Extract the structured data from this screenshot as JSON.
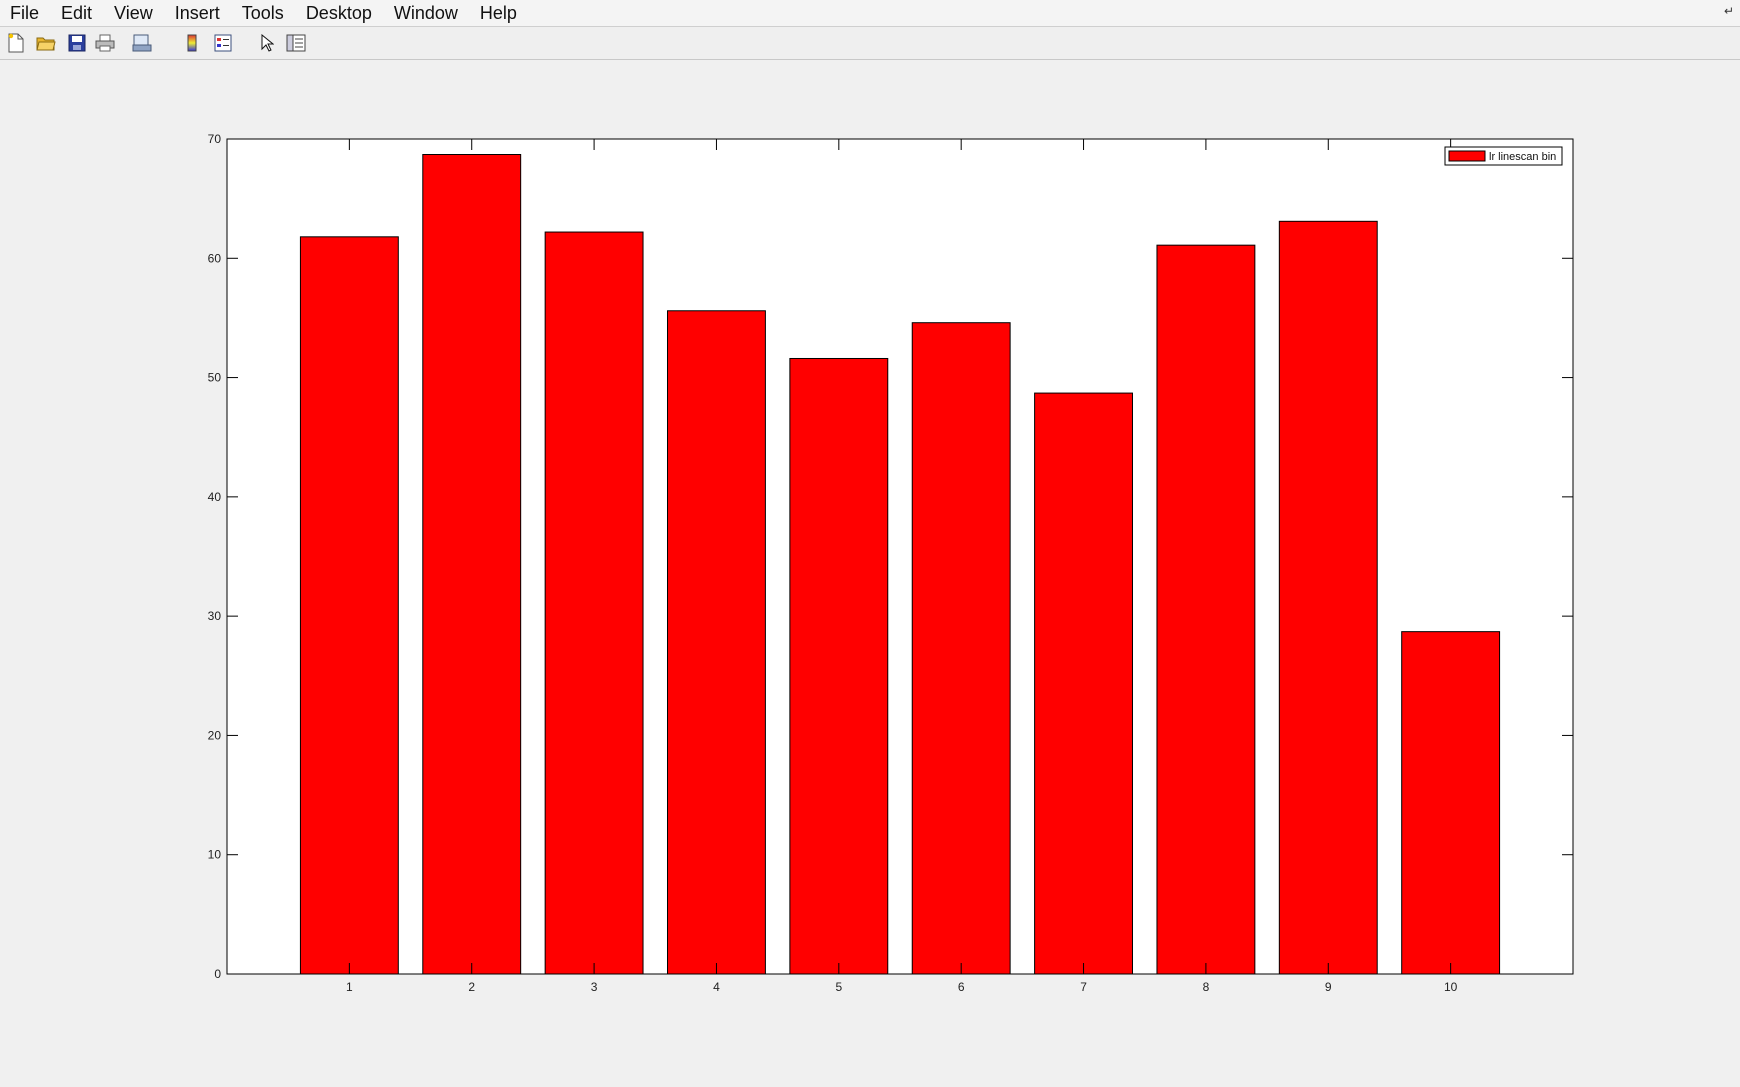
{
  "menu": {
    "items": [
      "File",
      "Edit",
      "View",
      "Insert",
      "Tools",
      "Desktop",
      "Window",
      "Help"
    ]
  },
  "toolbar": {
    "buttons": [
      {
        "icon": "new-figure-icon"
      },
      {
        "icon": "open-file-icon"
      },
      {
        "icon": "save-icon"
      },
      {
        "icon": "print-icon"
      },
      {
        "icon": "print-preview-icon"
      },
      {
        "icon": "colorbar-icon"
      },
      {
        "icon": "legend-icon"
      },
      {
        "icon": "pointer-icon"
      },
      {
        "icon": "property-inspector-icon"
      }
    ]
  },
  "colors": {
    "bar_fill": "#ff0000",
    "bar_edge": "#000000",
    "axes_bg": "#ffffff",
    "figure_bg": "#f0f0f0"
  },
  "chart_data": {
    "type": "bar",
    "categories": [
      "1",
      "2",
      "3",
      "4",
      "5",
      "6",
      "7",
      "8",
      "9",
      "10"
    ],
    "series": [
      {
        "name": "lr linescan bin",
        "values": [
          61.8,
          68.7,
          62.2,
          55.6,
          51.6,
          54.6,
          48.7,
          61.1,
          63.1,
          28.7
        ]
      }
    ],
    "title": "",
    "xlabel": "",
    "ylabel": "",
    "ylim": [
      0,
      70
    ],
    "yticks": [
      0,
      10,
      20,
      30,
      40,
      50,
      60,
      70
    ],
    "grid": false,
    "legend_location": "top-right"
  }
}
